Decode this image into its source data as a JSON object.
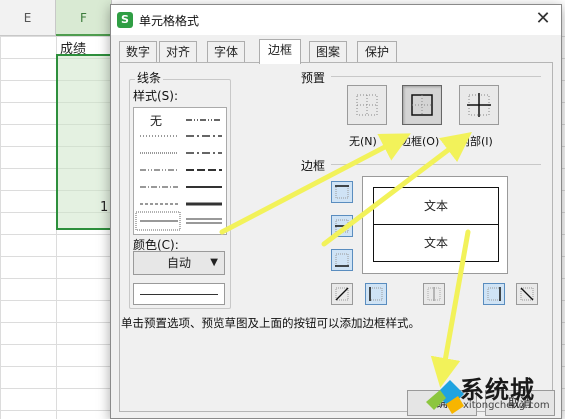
{
  "sheet": {
    "col_e": "E",
    "col_f": "F",
    "header_cell": "成绩",
    "partial_value": "1"
  },
  "dialog": {
    "title": "单元格格式",
    "app_icon": "S",
    "close_icon": "✕",
    "tabs": [
      "数字",
      "对齐",
      "字体",
      "边框",
      "图案",
      "保护"
    ],
    "active_tab": "边框"
  },
  "lines": {
    "group": "线条",
    "style_label": "样式(S):",
    "none_label": "无",
    "color_label": "颜色(C):",
    "color_value": "自动"
  },
  "presets": {
    "group": "预置",
    "none": "无(N)",
    "outline": "外边框(O)",
    "inside": "内部(I)"
  },
  "border": {
    "group": "边框",
    "preview_text_top": "文本",
    "preview_text_bottom": "文本"
  },
  "hint": "单击预置选项、预览草图及上面的按钮可以添加边框样式。",
  "buttons": {
    "ok": "确",
    "cancel": "取消"
  },
  "watermark": {
    "name": "系统城",
    "url": "xitongcheng.com"
  },
  "colors": {
    "accent_arrow": "#f2f25a",
    "selection": "#2d8f3c",
    "app_icon": "#2f9e44"
  }
}
